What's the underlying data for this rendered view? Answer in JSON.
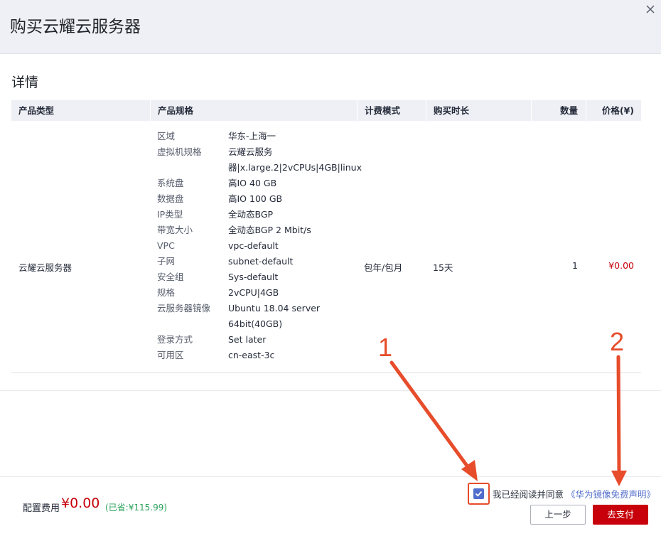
{
  "dialog": {
    "title": "购买云耀云服务器"
  },
  "section": {
    "title": "详情"
  },
  "table": {
    "headers": [
      "产品类型",
      "产品规格",
      "计费模式",
      "购买时长",
      "数量",
      "价格(¥)"
    ],
    "row": {
      "product_type": "云耀云服务器",
      "billing_mode": "包年/包月",
      "duration": "15天",
      "quantity": "1",
      "price": "¥0.00",
      "specs": [
        {
          "key": "区域",
          "value": "华东-上海一"
        },
        {
          "key": "虚拟机规格",
          "value": "云耀云服务"
        },
        {
          "key": "",
          "value": "器|x.large.2|2vCPUs|4GB|linux"
        },
        {
          "key": "系统盘",
          "value": "高IO 40 GB"
        },
        {
          "key": "数据盘",
          "value": "高IO 100 GB"
        },
        {
          "key": "IP类型",
          "value": "全动态BGP"
        },
        {
          "key": "带宽大小",
          "value": "全动态BGP 2 Mbit/s"
        },
        {
          "key": "VPC",
          "value": "vpc-default"
        },
        {
          "key": "子网",
          "value": "subnet-default"
        },
        {
          "key": "安全组",
          "value": "Sys-default"
        },
        {
          "key": "规格",
          "value": "2vCPU|4GB"
        },
        {
          "key": "云服务器镜像",
          "value": "Ubuntu 18.04 server"
        },
        {
          "key": "",
          "value": "64bit(40GB)"
        },
        {
          "key": "登录方式",
          "value": "Set later"
        },
        {
          "key": "可用区",
          "value": "cn-east-3c"
        }
      ]
    }
  },
  "footer": {
    "fee_label": "配置费用",
    "fee_value": "¥0.00",
    "saved": "(已省:¥115.99)",
    "agree_text": "我已经阅读并同意",
    "agree_link": "《华为镜像免费声明》",
    "agree_checked": true,
    "prev_button": "上一步",
    "pay_button": "去支付"
  },
  "annotations": [
    "1",
    "2"
  ],
  "colors": {
    "accent_red": "#c7000b",
    "link_blue": "#526ecc",
    "annotation_red": "#e74c2b",
    "saved_green": "#2aa05a"
  },
  "icons": {
    "close": "close-icon",
    "check": "check-icon"
  }
}
